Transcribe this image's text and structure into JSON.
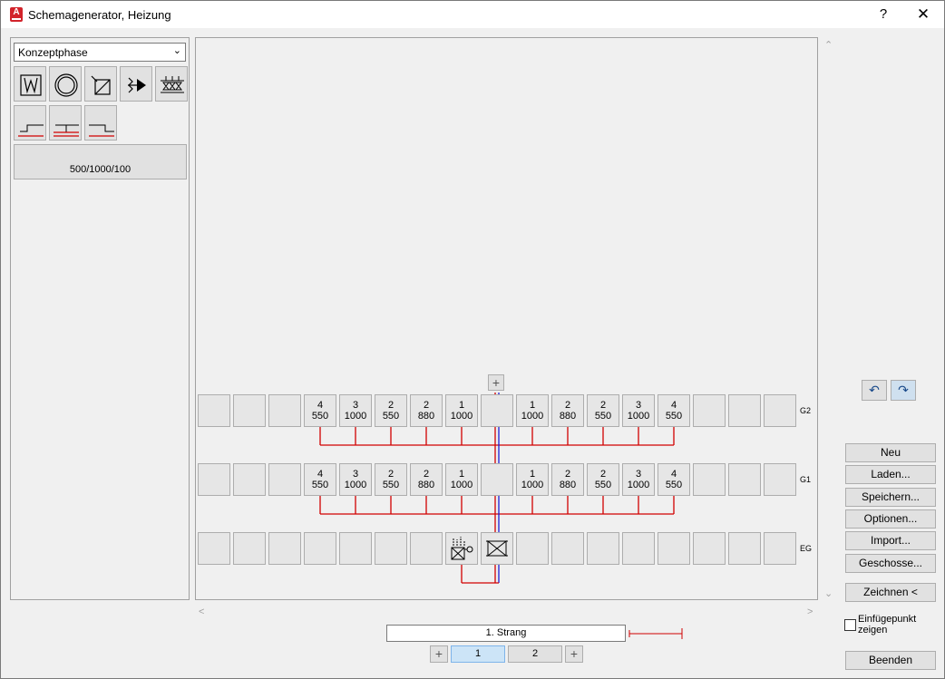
{
  "window": {
    "title": "Schemagenerator, Heizung",
    "help": "?",
    "close": "✕"
  },
  "left": {
    "phase": "Konzeptphase",
    "tools_row1": [
      "radiator-icon",
      "circle-icon",
      "mixer-icon",
      "pump-valve-icon",
      "manifold-icon"
    ],
    "tools_row2": [
      "floor-connection-1-icon",
      "floor-connection-2-icon",
      "floor-connection-3-icon"
    ],
    "dimension_button": "500/1000/100"
  },
  "canvas": {
    "add_strang_button": "+",
    "floors": [
      {
        "label": "G2",
        "cells": [
          {
            "top": "",
            "bottom": ""
          },
          {
            "top": "",
            "bottom": ""
          },
          {
            "top": "",
            "bottom": ""
          },
          {
            "top": "4",
            "bottom": "550"
          },
          {
            "top": "3",
            "bottom": "1000"
          },
          {
            "top": "2",
            "bottom": "550"
          },
          {
            "top": "2",
            "bottom": "880"
          },
          {
            "top": "1",
            "bottom": "1000"
          },
          {
            "top": "",
            "bottom": ""
          },
          {
            "top": "1",
            "bottom": "1000"
          },
          {
            "top": "2",
            "bottom": "880"
          },
          {
            "top": "2",
            "bottom": "550"
          },
          {
            "top": "3",
            "bottom": "1000"
          },
          {
            "top": "4",
            "bottom": "550"
          },
          {
            "top": "",
            "bottom": ""
          },
          {
            "top": "",
            "bottom": ""
          },
          {
            "top": "",
            "bottom": ""
          }
        ]
      },
      {
        "label": "G1",
        "cells": [
          {
            "top": "",
            "bottom": ""
          },
          {
            "top": "",
            "bottom": ""
          },
          {
            "top": "",
            "bottom": ""
          },
          {
            "top": "4",
            "bottom": "550"
          },
          {
            "top": "3",
            "bottom": "1000"
          },
          {
            "top": "2",
            "bottom": "550"
          },
          {
            "top": "2",
            "bottom": "880"
          },
          {
            "top": "1",
            "bottom": "1000"
          },
          {
            "top": "",
            "bottom": ""
          },
          {
            "top": "1",
            "bottom": "1000"
          },
          {
            "top": "2",
            "bottom": "880"
          },
          {
            "top": "2",
            "bottom": "550"
          },
          {
            "top": "3",
            "bottom": "1000"
          },
          {
            "top": "4",
            "bottom": "550"
          },
          {
            "top": "",
            "bottom": ""
          },
          {
            "top": "",
            "bottom": ""
          },
          {
            "top": "",
            "bottom": ""
          }
        ]
      },
      {
        "label": "EG",
        "cells": [
          {
            "top": "",
            "bottom": ""
          },
          {
            "top": "",
            "bottom": ""
          },
          {
            "top": "",
            "bottom": ""
          },
          {
            "top": "",
            "bottom": ""
          },
          {
            "top": "",
            "bottom": ""
          },
          {
            "top": "",
            "bottom": ""
          },
          {
            "top": "",
            "bottom": ""
          },
          {
            "top": "",
            "bottom": "",
            "icon": "boiler-icon"
          },
          {
            "top": "",
            "bottom": "",
            "icon": "valve-icon"
          },
          {
            "top": "",
            "bottom": ""
          },
          {
            "top": "",
            "bottom": ""
          },
          {
            "top": "",
            "bottom": ""
          },
          {
            "top": "",
            "bottom": ""
          },
          {
            "top": "",
            "bottom": ""
          },
          {
            "top": "",
            "bottom": ""
          },
          {
            "top": "",
            "bottom": ""
          },
          {
            "top": "",
            "bottom": ""
          }
        ]
      }
    ],
    "colors": {
      "return_pipe": "#d10000",
      "supply_pipe": "#1c1cd4"
    }
  },
  "bottom": {
    "strang": "1. Strang",
    "pages": [
      "1",
      "2"
    ],
    "active_page": "1",
    "plus": "+"
  },
  "right": {
    "undo": "↶",
    "redo": "↷",
    "buttons": [
      "Neu",
      "Laden...",
      "Speichern...",
      "Optionen...",
      "Import...",
      "Geschosse..."
    ],
    "draw": "Zeichnen <",
    "insert_point_label": "Einfügepunkt zeigen",
    "insert_point_checked": false,
    "exit": "Beenden"
  }
}
